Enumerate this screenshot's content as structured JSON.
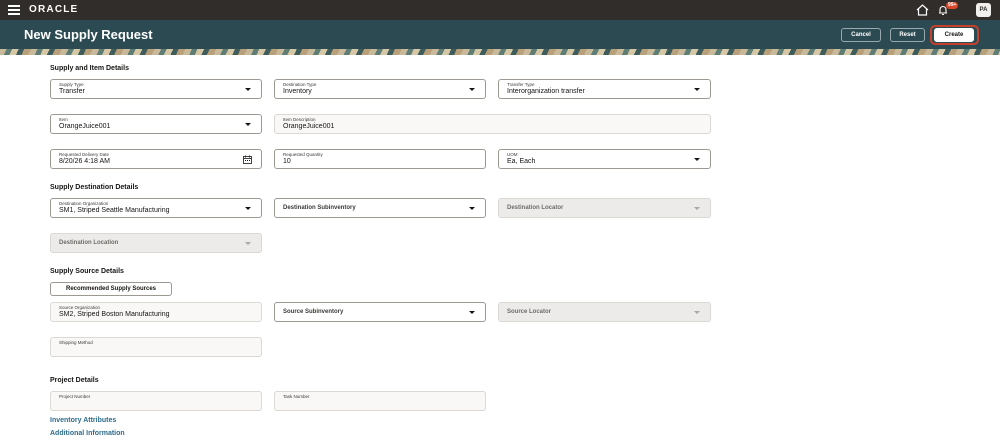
{
  "topbar": {
    "logo": "ORACLE",
    "notifications_badge": "99+",
    "avatar_initials": "PA"
  },
  "header": {
    "title": "New Supply Request",
    "cancel_label": "Cancel",
    "reset_label": "Reset",
    "create_label": "Create"
  },
  "supply_item": {
    "section_title": "Supply and Item Details",
    "supply_type": {
      "label": "Supply Type",
      "value": "Transfer"
    },
    "destination_type": {
      "label": "Destination Type",
      "value": "Inventory"
    },
    "transfer_type": {
      "label": "Transfer Type",
      "value": "Interorganization transfer"
    },
    "item": {
      "label": "Item",
      "value": "OrangeJuice001"
    },
    "item_description": {
      "label": "Item Description",
      "value": "OrangeJuice001"
    },
    "requested_delivery_date": {
      "label": "Requested Delivery Date",
      "value": "8/20/26 4:18 AM"
    },
    "requested_quantity": {
      "label": "Requested Quantity",
      "value": "10"
    },
    "uom": {
      "label": "UOM",
      "value": "Ea,  Each"
    }
  },
  "destination": {
    "section_title": "Supply Destination Details",
    "destination_organization": {
      "label": "Destination Organization",
      "value": "SM1,  Striped Seattle Manufacturing"
    },
    "destination_subinventory": {
      "placeholder": "Destination Subinventory"
    },
    "destination_locator": {
      "placeholder": "Destination Locator"
    },
    "destination_location": {
      "placeholder": "Destination Location"
    }
  },
  "source": {
    "section_title": "Supply Source Details",
    "recommended_button": "Recommended Supply Sources",
    "source_organization": {
      "label": "Source Organization",
      "value": "SM2, Striped Boston Manufacturing"
    },
    "source_subinventory": {
      "placeholder": "Source Subinventory"
    },
    "source_locator": {
      "placeholder": "Source Locator"
    },
    "shipping_method": {
      "label": "Shipping Method"
    }
  },
  "project": {
    "section_title": "Project Details",
    "project_number": {
      "label": "Project Number"
    },
    "task_number": {
      "label": "Task Number"
    }
  },
  "links": {
    "inventory_attributes": "Inventory Attributes",
    "additional_information": "Additional Information"
  },
  "colors": {
    "topbar": "#312d2a",
    "header": "#2b4a52",
    "link": "#2e6b8a",
    "highlight_ring": "#c7402d"
  }
}
